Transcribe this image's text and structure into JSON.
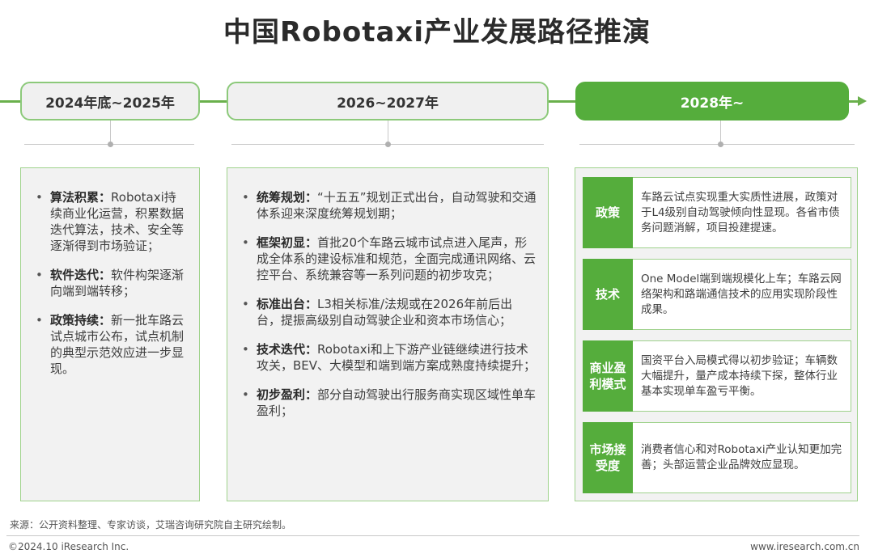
{
  "title": "中国Robotaxi产业发展路径推演",
  "colors": {
    "accent": "#55ad3c",
    "border": "#9fd28c",
    "panel_bg": "#f2f2f2"
  },
  "stages": [
    {
      "label": "2024年底~2025年",
      "active": false
    },
    {
      "label": "2026~2027年",
      "active": false
    },
    {
      "label": "2028年~",
      "active": true
    }
  ],
  "panel1": {
    "items": [
      {
        "head": "算法积累：",
        "text": "Robotaxi持续商业化运营，积累数据迭代算法，技术、安全等逐渐得到市场验证；"
      },
      {
        "head": "软件迭代：",
        "text": "软件构架逐渐向端到端转移；"
      },
      {
        "head": "政策持续：",
        "text": "新一批车路云试点城市公布，试点机制的典型示范效应进一步显现。"
      }
    ]
  },
  "panel2": {
    "items": [
      {
        "head": "统筹规划：",
        "text": "“十五五”规划正式出台，自动驾驶和交通体系迎来深度统筹规划期；"
      },
      {
        "head": "框架初显：",
        "text": "首批20个车路云城市试点进入尾声，形成全体系的建设标准和规范，全面完成通讯网络、云控平台、系统兼容等一系列问题的初步攻克；"
      },
      {
        "head": "标准出台：",
        "text": "L3相关标准/法规或在2026年前后出台，提振高级别自动驾驶企业和资本市场信心；"
      },
      {
        "head": "技术迭代：",
        "text": "Robotaxi和上下游产业链继续进行技术攻关，BEV、大模型和端到端方案成熟度持续提升；"
      },
      {
        "head": "初步盈利：",
        "text": "部分自动驾驶出行服务商实现区域性单车盈利；"
      }
    ]
  },
  "panel3": {
    "rows": [
      {
        "tag": "政策",
        "text": "车路云试点实现重大实质性进展，政策对于L4级别自动驾驶倾向性显现。各省市债务问题消解，项目投建提速。"
      },
      {
        "tag": "技术",
        "text": "One Model端到端规模化上车；车路云网络架构和路端通信技术的应用实现阶段性成果。"
      },
      {
        "tag": "商业盈利模式",
        "text": "国资平台入局模式得以初步验证；车辆数大幅提升，量产成本持续下探，整体行业基本实现单车盈亏平衡。"
      },
      {
        "tag": "市场接受度",
        "text": "消费者信心和对Robotaxi产业认知更加完善；头部运营企业品牌效应显现。"
      }
    ]
  },
  "footer": {
    "source": "来源：公开资料整理、专家访谈，艾瑞咨询研究院自主研究绘制。",
    "copyright": "©2024.10 iResearch Inc.",
    "site": "www.iresearch.com.cn"
  }
}
